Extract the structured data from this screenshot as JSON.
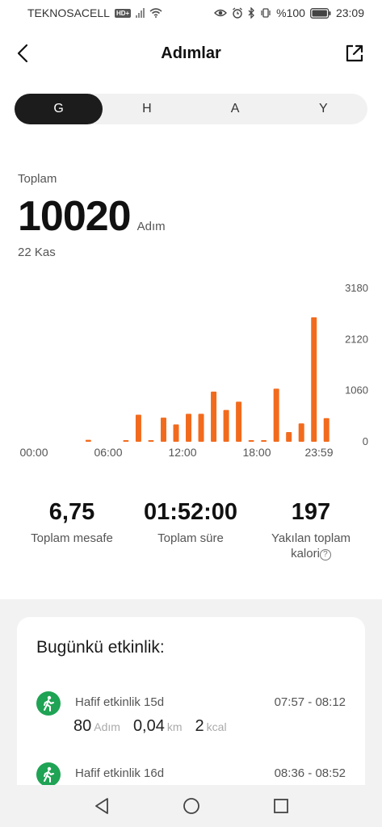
{
  "status": {
    "carrier": "TEKNOSACELL",
    "hd_badge": "HD+",
    "battery": "%100",
    "time": "23:09"
  },
  "header": {
    "title": "Adımlar"
  },
  "tabs": [
    "G",
    "H",
    "A",
    "Y"
  ],
  "summary": {
    "total_label": "Toplam",
    "total_value": "10020",
    "total_unit": "Adım",
    "date": "22 Kas"
  },
  "chart_data": {
    "type": "bar",
    "x_ticks": [
      "00:00",
      "06:00",
      "12:00",
      "18:00",
      "23:59"
    ],
    "y_ticks": [
      "3180",
      "2120",
      "1060",
      "0"
    ],
    "ylim": [
      0,
      3180
    ],
    "color": "#f26b1d",
    "bars": [
      {
        "slot": 5,
        "value": 40
      },
      {
        "slot": 8,
        "value": 20
      },
      {
        "slot": 9,
        "value": 560
      },
      {
        "slot": 10,
        "value": 20
      },
      {
        "slot": 11,
        "value": 500
      },
      {
        "slot": 12,
        "value": 360
      },
      {
        "slot": 13,
        "value": 580
      },
      {
        "slot": 14,
        "value": 580
      },
      {
        "slot": 15,
        "value": 1040
      },
      {
        "slot": 16,
        "value": 660
      },
      {
        "slot": 17,
        "value": 830
      },
      {
        "slot": 18,
        "value": 30
      },
      {
        "slot": 19,
        "value": 20
      },
      {
        "slot": 20,
        "value": 1100
      },
      {
        "slot": 21,
        "value": 200
      },
      {
        "slot": 22,
        "value": 380
      },
      {
        "slot": 23,
        "value": 2580
      },
      {
        "slot": 24,
        "value": 490
      }
    ]
  },
  "stats": [
    {
      "value": "6,75",
      "label": "Toplam mesafe"
    },
    {
      "value": "01:52:00",
      "label": "Toplam süre"
    },
    {
      "value": "197",
      "label_line1": "Yakılan toplam",
      "label_line2": "kalori"
    }
  ],
  "activity": {
    "title": "Bugünkü etkinlik:",
    "items": [
      {
        "name": "Hafif etkinlik 15d",
        "time": "07:57 - 08:12",
        "steps": "80",
        "steps_unit": "Adım",
        "distance": "0,04",
        "distance_unit": "km",
        "calories": "2",
        "calories_unit": "kcal"
      },
      {
        "name": "Hafif etkinlik 16d",
        "time": "08:36 - 08:52"
      }
    ]
  }
}
